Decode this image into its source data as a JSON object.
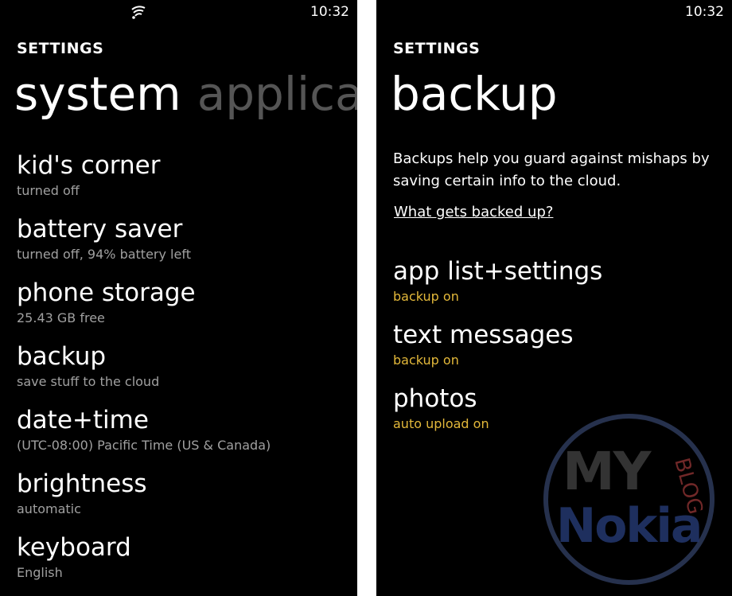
{
  "left": {
    "clock": "10:32",
    "header": "SETTINGS",
    "pivot_active": "system",
    "pivot_next": "applicat",
    "items": [
      {
        "title": "kid's corner",
        "subtitle": "turned off"
      },
      {
        "title": "battery saver",
        "subtitle": "turned off, 94% battery left"
      },
      {
        "title": "phone storage",
        "subtitle": "25.43 GB free"
      },
      {
        "title": "backup",
        "subtitle": "save stuff to the cloud"
      },
      {
        "title": "date+time",
        "subtitle": "(UTC-08:00) Pacific Time (US & Canada)"
      },
      {
        "title": "brightness",
        "subtitle": "automatic"
      },
      {
        "title": "keyboard",
        "subtitle": "English"
      }
    ]
  },
  "right": {
    "clock": "10:32",
    "header": "SETTINGS",
    "title": "backup",
    "description": "Backups help you guard against mishaps by saving certain info to the cloud.",
    "link": "What gets backed up?",
    "items": [
      {
        "title": "app list+settings",
        "subtitle": "backup on"
      },
      {
        "title": "text messages",
        "subtitle": "backup on"
      },
      {
        "title": "photos",
        "subtitle": "auto upload on"
      }
    ],
    "accent_color": "#e3b83a"
  },
  "watermark": {
    "line1": "MY",
    "line2": "Nokia",
    "side": "BLOG"
  }
}
